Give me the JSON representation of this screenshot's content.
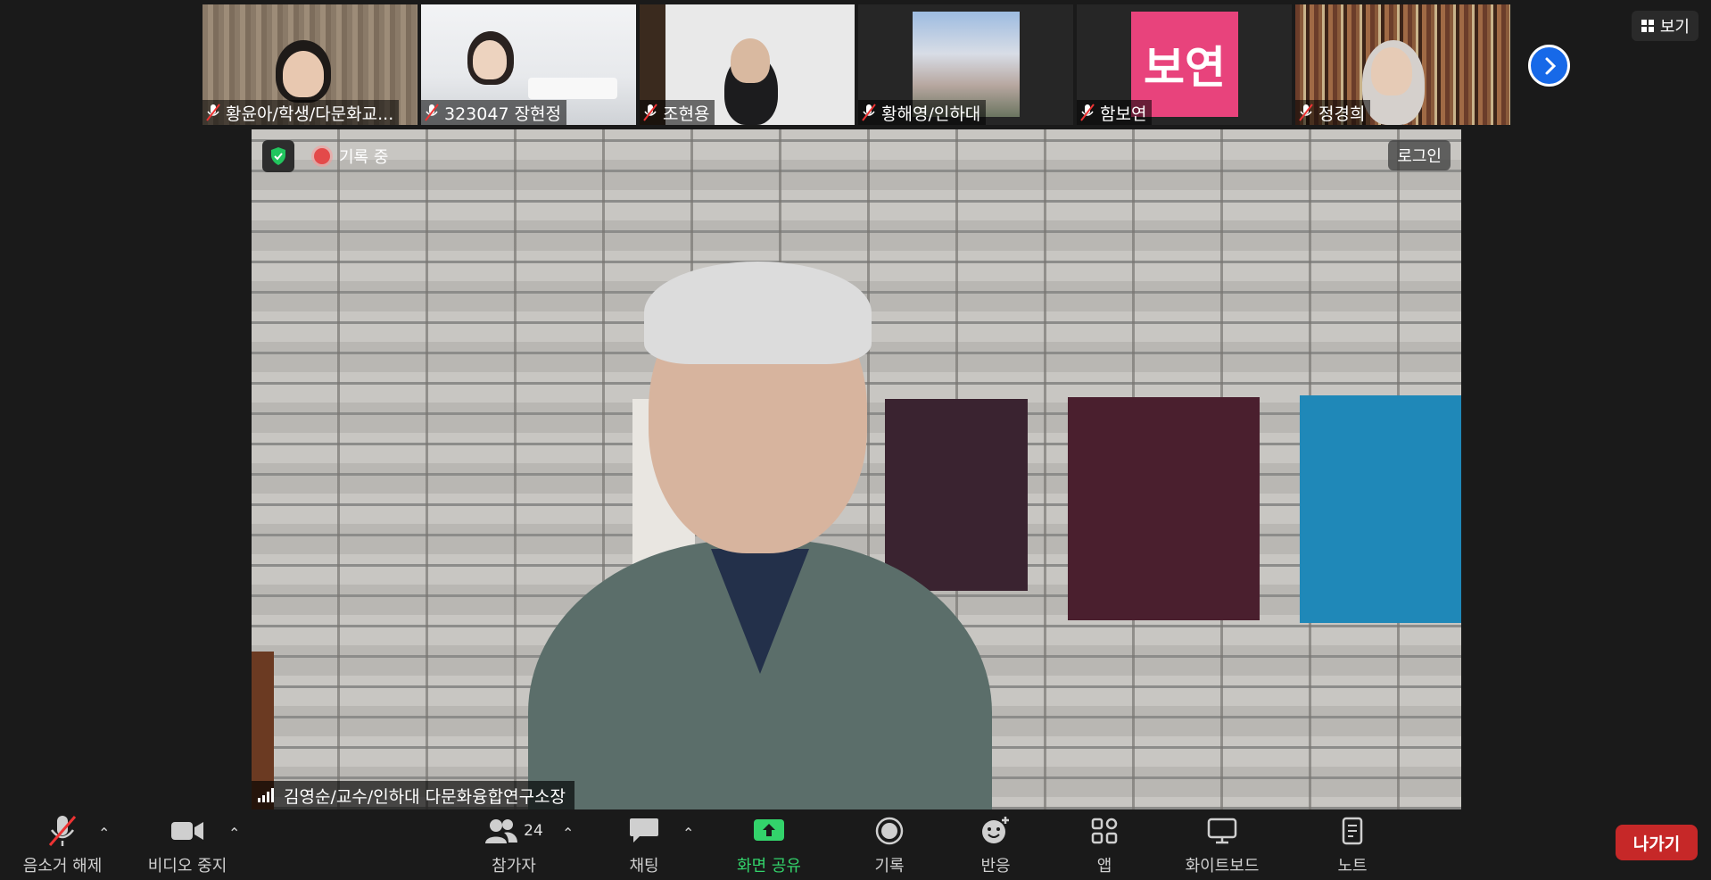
{
  "participants_strip": [
    {
      "name": "황윤아/학생/다문화교...",
      "muted": true
    },
    {
      "name": "323047 장현정",
      "muted": true
    },
    {
      "name": "조현용",
      "muted": true
    },
    {
      "name": "황해영/인하대",
      "muted": true
    },
    {
      "name": "함보연",
      "muted": true,
      "avatar_text": "보연",
      "avatar_color": "#e8437c"
    },
    {
      "name": "정경희",
      "muted": true
    }
  ],
  "view_button": "보기",
  "recording_label": "기록 중",
  "login_label": "로그인",
  "speaker_name": "김영순/교수/인하대 다문화융합연구소장",
  "toolbar": {
    "unmute": "음소거 해제",
    "stop_video": "비디오 중지",
    "participants": "참가자",
    "participants_count": "24",
    "chat": "채팅",
    "share_screen": "화면 공유",
    "record": "기록",
    "reactions": "반응",
    "apps": "앱",
    "whiteboard": "화이트보드",
    "notes": "노트",
    "leave": "나가기"
  },
  "colors": {
    "accent": "#1769e8",
    "share_green": "#33d36b",
    "leave_red": "#c62828",
    "avatar_pink": "#e8437c"
  }
}
